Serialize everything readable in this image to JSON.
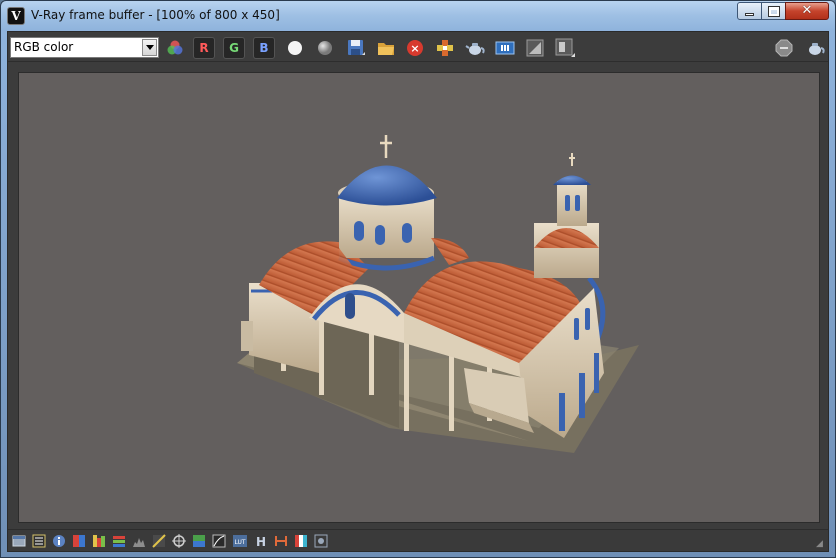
{
  "window": {
    "title": "V-Ray frame buffer - [100% of 800 x 450]",
    "app_icon_glyph": "V"
  },
  "toolbar": {
    "channel_select_value": "RGB color",
    "red_channel_label": "R",
    "green_channel_label": "G",
    "blue_channel_label": "B",
    "icons": [
      "color-wheel-icon",
      "white-circle-icon",
      "gray-circle-icon",
      "save-icon",
      "open-folder-icon",
      "clear-image-icon",
      "track-mouse-icon",
      "teapot-render-icon",
      "region-render-icon",
      "compare-a-icon",
      "compare-b-icon",
      "stop-render-icon",
      "teapot-render-last-icon"
    ]
  },
  "status_bar": {
    "icons": [
      "window-icon",
      "history-icon",
      "info-icon",
      "color-correction-icon",
      "levels-icon",
      "curves-icon",
      "histogram-icon",
      "gamma-icon",
      "exposure-icon",
      "lut-icon",
      "graph-icon",
      "lut-text-icon",
      "h-icon",
      "hsv-icon",
      "rgb-icon",
      "settings-icon"
    ]
  },
  "colors": {
    "viewport_bg": "#635f5e",
    "toolbar_bg": "#3c3c3c",
    "dome_blue": "#3a63b0",
    "roof_orange": "#c8643e"
  }
}
